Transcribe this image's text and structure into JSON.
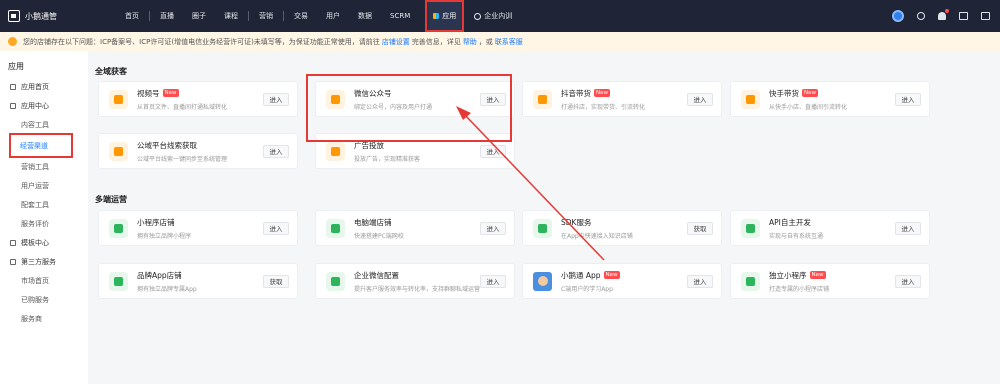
{
  "topnav": {
    "logo_text": "小鹅通管",
    "items": [
      "首页",
      "直播",
      "圈子",
      "课程",
      "营销",
      "交易",
      "用户",
      "数据",
      "SCRM"
    ],
    "active": "应用",
    "org": "企业内训"
  },
  "notice": {
    "text": "您的店铺存在以下问题：ICP备案号、ICP许可证(增值电信业务经营许可证)未填写等，为保证功能正常使用，请前往",
    "link1": "店铺设置",
    "mid": "完善信息，详见",
    "link2": "帮助",
    "tail": "，或",
    "link3": "联系客服"
  },
  "sidebar": {
    "title": "应用",
    "items": [
      {
        "label": "应用首页",
        "type": "item"
      },
      {
        "label": "应用中心",
        "type": "item"
      },
      {
        "label": "内容工具",
        "type": "sub"
      },
      {
        "label": "经营渠道",
        "type": "sub",
        "active": true
      },
      {
        "label": "营销工具",
        "type": "sub"
      },
      {
        "label": "用户运营",
        "type": "sub"
      },
      {
        "label": "配套工具",
        "type": "sub"
      },
      {
        "label": "服务评价",
        "type": "sub"
      },
      {
        "label": "模板中心",
        "type": "item"
      },
      {
        "label": "第三方服务",
        "type": "item"
      },
      {
        "label": "市场首页",
        "type": "sub"
      },
      {
        "label": "已购服务",
        "type": "sub"
      },
      {
        "label": "服务商",
        "type": "sub"
      }
    ]
  },
  "sections": [
    {
      "title": "全域获客",
      "cards": [
        {
          "name": "视频号",
          "new": true,
          "desc": "从首页文件、直播间打通私域转化",
          "btn": "进入",
          "icon": "video-icon",
          "color": "orange"
        },
        {
          "name": "微信公众号",
          "new": false,
          "desc": "绑定公众号，内容及用户打通",
          "btn": "进入",
          "icon": "wechat-official-icon",
          "color": "orange"
        },
        {
          "name": "抖音带货",
          "new": true,
          "desc": "打通抖店，实现带货、引流转化",
          "btn": "进入",
          "icon": "douyin-cart-icon",
          "color": "orange"
        },
        {
          "name": "快手带货",
          "new": true,
          "desc": "从快手小店、直播间引流转化",
          "btn": "进入",
          "icon": "kuaishou-cart-icon",
          "color": "orange"
        },
        {
          "name": "公域平台线索获取",
          "new": false,
          "desc": "公域平台线索一键同步至系统管理",
          "btn": "进入",
          "icon": "lead-icon",
          "color": "orange"
        },
        {
          "name": "广告投放",
          "new": false,
          "desc": "投放广告，实现精准获客",
          "btn": "进入",
          "icon": "ad-icon",
          "color": "orange"
        }
      ]
    },
    {
      "title": "多端运营",
      "cards": [
        {
          "name": "小程序店铺",
          "new": false,
          "desc": "拥有独立品牌小程序",
          "btn": "进入",
          "icon": "miniprogram-icon",
          "color": "green"
        },
        {
          "name": "电脑端店铺",
          "new": false,
          "desc": "快速搭建PC端网校",
          "btn": "进入",
          "icon": "pc-store-icon",
          "color": "green"
        },
        {
          "name": "SDK服务",
          "new": false,
          "desc": "在App中快速接入知识店铺",
          "btn": "获取",
          "icon": "sdk-download-icon",
          "color": "green"
        },
        {
          "name": "API自主开发",
          "new": false,
          "desc": "实现与自有系统互通",
          "btn": "进入",
          "icon": "api-icon",
          "color": "green"
        },
        {
          "name": "品牌App店铺",
          "new": false,
          "desc": "拥有独立品牌专属App",
          "btn": "获取",
          "icon": "app-store-icon",
          "color": "green"
        },
        {
          "name": "企业微信配置",
          "new": false,
          "desc": "提升客户服务效率与转化率，支持群聊私域运营等",
          "btn": "进入",
          "icon": "wecom-icon",
          "color": "green"
        },
        {
          "name": "小鹅通 App",
          "new": true,
          "desc": "C端用户的学习App",
          "btn": "进入",
          "icon": "xiaoe-app-icon",
          "color": "photo"
        },
        {
          "name": "独立小程序",
          "new": true,
          "desc": "打造专属的小程序店铺",
          "btn": "进入",
          "icon": "standalone-miniprogram-icon",
          "color": "green"
        }
      ]
    }
  ],
  "colors": {
    "nav_bg": "#1f2536",
    "accent": "#1677ff",
    "annotation_red": "#e53935",
    "new_badge": "#ff4d4f"
  }
}
